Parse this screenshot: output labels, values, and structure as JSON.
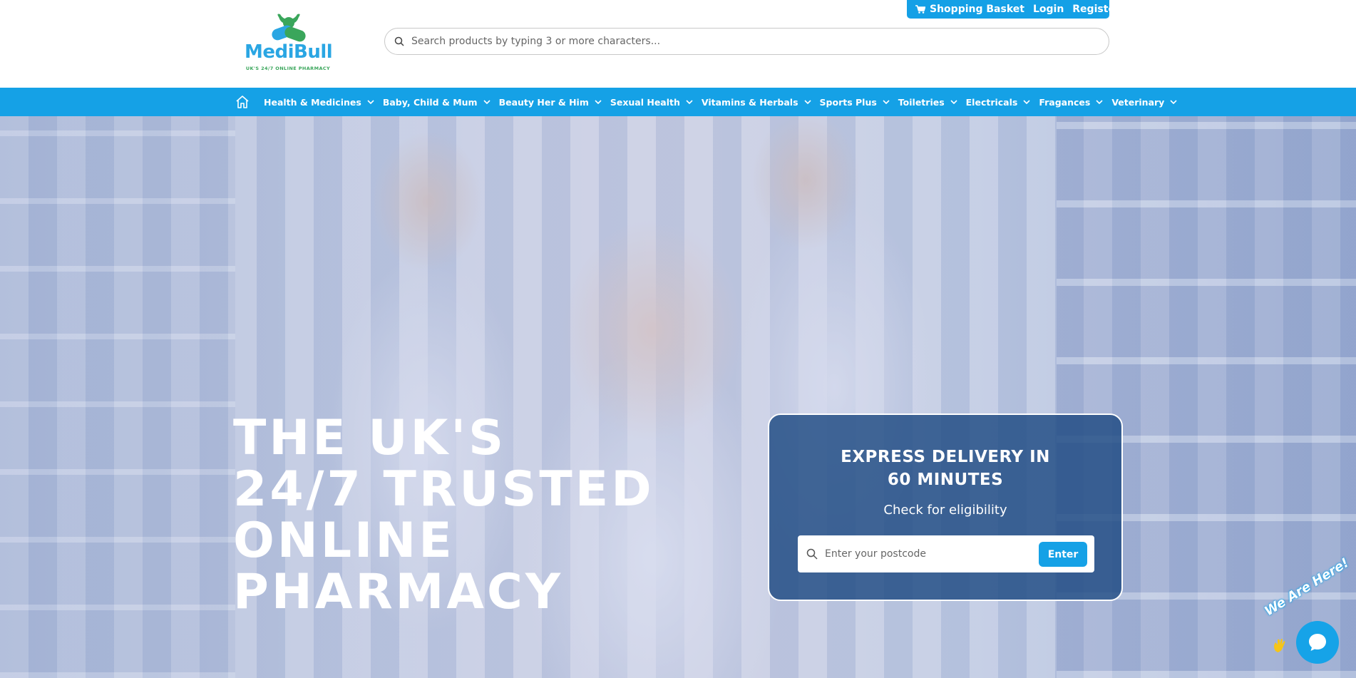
{
  "brand": {
    "name": "MediBull",
    "tagline": "UK'S 24/7 ONLINE PHARMACY",
    "primary_color": "#15a1e6",
    "accent_green": "#3aa65b"
  },
  "topbar": {
    "basket_label": "Shopping Basket",
    "login_label": "Login",
    "register_label": "Register"
  },
  "search": {
    "placeholder": "Search products by typing 3 or more characters..."
  },
  "nav": {
    "home_icon": "home-icon",
    "items": [
      {
        "label": "Health & Medicines"
      },
      {
        "label": "Baby, Child & Mum"
      },
      {
        "label": "Beauty Her & Him"
      },
      {
        "label": "Sexual Health"
      },
      {
        "label": "Vitamins & Herbals"
      },
      {
        "label": "Sports Plus"
      },
      {
        "label": "Toiletries"
      },
      {
        "label": "Electricals"
      },
      {
        "label": "Fragances"
      },
      {
        "label": "Veterinary"
      }
    ]
  },
  "hero": {
    "headline_lines": [
      "THE UK'S",
      "24/7 TRUSTED",
      "ONLINE",
      "PHARMACY"
    ]
  },
  "delivery": {
    "title": "EXPRESS DELIVERY IN 60 MINUTES",
    "subtitle": "Check for eligibility",
    "postcode_placeholder": "Enter your postcode",
    "enter_label": "Enter"
  },
  "chat": {
    "tag": "We Are Here!"
  }
}
